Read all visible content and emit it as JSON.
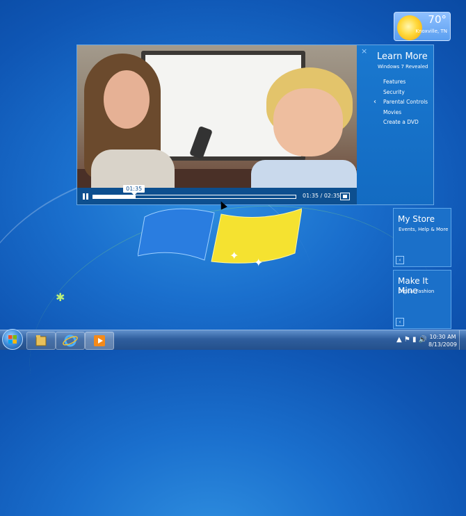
{
  "weather": {
    "temperature": "70°",
    "city": "Knoxville, TN"
  },
  "player": {
    "tooltip_time": "01:35",
    "time_display": "01:35 / 02:35",
    "progress": 0.21
  },
  "panel": {
    "close_icon": "×",
    "title": "Learn More",
    "subtitle": "Windows 7 Revealed",
    "items": [
      "Features",
      "Security",
      "Parental Controls",
      "Movies",
      "Create a DVD"
    ],
    "selected_index": 2
  },
  "tiles": [
    {
      "title": "My Store",
      "subtitle": "Events, Help & More"
    },
    {
      "title": "Make It Mine",
      "subtitle": "Digital Fashion"
    }
  ],
  "taskbar": {
    "items": [
      "start-button",
      "explorer-icon",
      "internet-explorer-icon",
      "media-player-icon"
    ],
    "clock_time": "10:30 AM",
    "clock_date": "8/13/2009",
    "accent": "#2f5e9d"
  }
}
